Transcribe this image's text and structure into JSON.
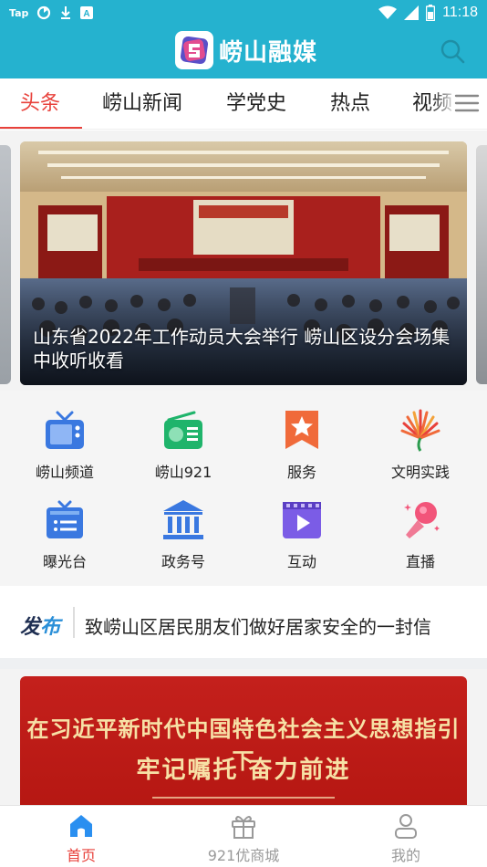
{
  "status_bar": {
    "left_label": "Tap",
    "time": "11:18",
    "icons": [
      "sync-icon",
      "download-icon",
      "a-app-icon",
      "wifi-icon",
      "signal-icon",
      "battery-icon"
    ]
  },
  "header": {
    "title": "崂山融媒",
    "logo_icon": "app-logo-icon",
    "search_icon": "search-icon",
    "bg_color": "#25b2cf"
  },
  "tabs": {
    "items": [
      "头条",
      "崂山新闻",
      "学党史",
      "热点",
      "视频"
    ],
    "active_index": 0,
    "active_color": "#e8413b",
    "menu_icon": "menu-icon"
  },
  "carousel": {
    "caption": "山东省2022年工作动员大会举行 崂山区设分会场集中收听收看"
  },
  "grid": {
    "items": [
      {
        "label": "崂山频道",
        "icon": "tv-icon"
      },
      {
        "label": "崂山921",
        "icon": "radio-icon"
      },
      {
        "label": "服务",
        "icon": "bookmark-star-icon"
      },
      {
        "label": "文明实践",
        "icon": "civilization-emblem-icon"
      },
      {
        "label": "曝光台",
        "icon": "exposure-box-icon"
      },
      {
        "label": "政务号",
        "icon": "government-building-icon"
      },
      {
        "label": "互动",
        "icon": "video-play-icon"
      },
      {
        "label": "直播",
        "icon": "microphone-icon"
      }
    ]
  },
  "announcement": {
    "badge": "发布",
    "text": "致崂山区居民朋友们做好居家安全的一封信"
  },
  "banner": {
    "line1": "在习近平新时代中国特色社会主义思想指引下",
    "line2": "牢记嘱托 奋力前进"
  },
  "bottom_nav": {
    "items": [
      {
        "label": "首页",
        "icon": "home-icon"
      },
      {
        "label": "921优商城",
        "icon": "gift-icon"
      },
      {
        "label": "我的",
        "icon": "user-icon"
      }
    ],
    "active_index": 0
  }
}
